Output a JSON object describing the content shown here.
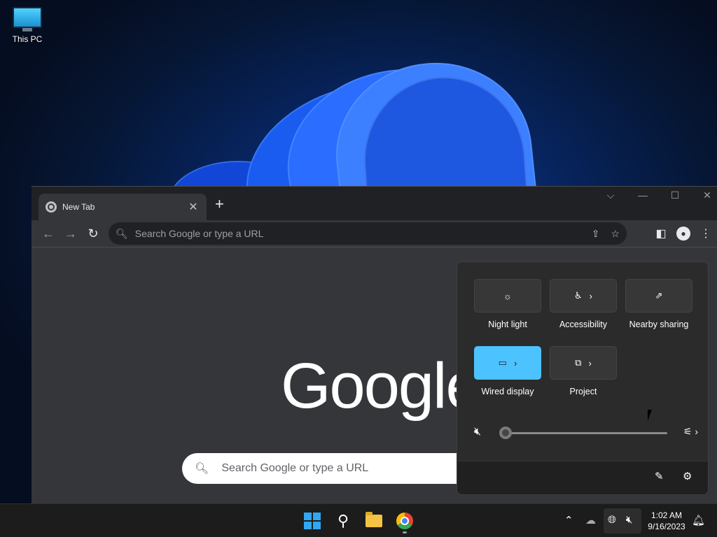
{
  "desktop": {
    "icon_label": "This PC"
  },
  "browser": {
    "tab_title": "New Tab",
    "omnibox_placeholder": "Search Google or type a URL",
    "logo_text": "Google",
    "ntp_search_placeholder": "Search Google or type a URL"
  },
  "quick_settings": {
    "tiles": [
      {
        "label": "Night light",
        "icon": "night-light-icon",
        "active": false,
        "has_chevron": false
      },
      {
        "label": "Accessibility",
        "icon": "accessibility-icon",
        "active": false,
        "has_chevron": true
      },
      {
        "label": "Nearby sharing",
        "icon": "share-icon",
        "active": false,
        "has_chevron": false
      },
      {
        "label": "Wired display",
        "icon": "cast-icon",
        "active": true,
        "has_chevron": true
      },
      {
        "label": "Project",
        "icon": "project-icon",
        "active": false,
        "has_chevron": true
      }
    ],
    "volume_level": 0,
    "volume_muted": true,
    "active_color": "#4cc2ff"
  },
  "taskbar": {
    "time": "1:02 AM",
    "date": "9/16/2023"
  }
}
